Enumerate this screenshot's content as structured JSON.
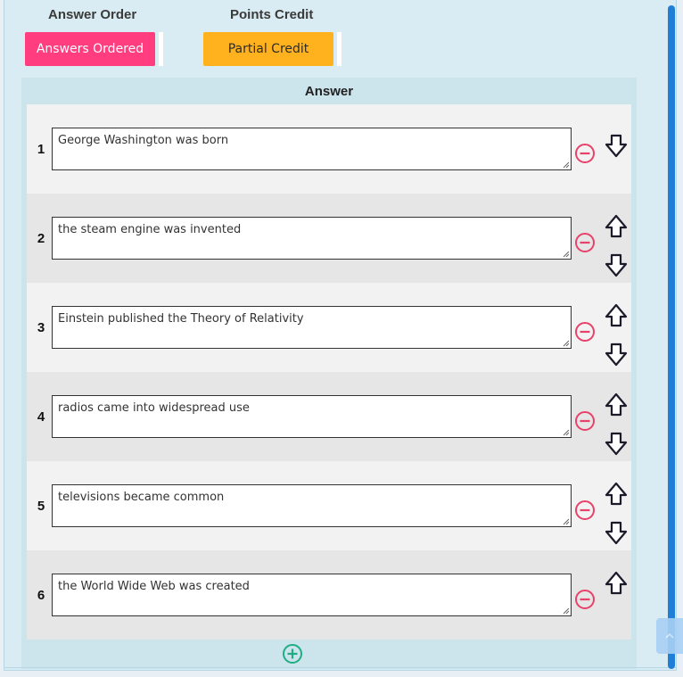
{
  "settings": {
    "answer_order_title": "Answer Order",
    "points_credit_title": "Points Credit",
    "answer_order_button": "Answers Ordered",
    "points_credit_button": "Partial Credit",
    "answer_order_color": "#ff3d7f",
    "points_credit_color": "#ffb21d"
  },
  "answers": {
    "header": "Answer",
    "rows": [
      {
        "number": "1",
        "text": "George Washington was born"
      },
      {
        "number": "2",
        "text": "the steam engine was invented"
      },
      {
        "number": "3",
        "text": "Einstein published the Theory of Relativity"
      },
      {
        "number": "4",
        "text": "radios came into widespread use"
      },
      {
        "number": "5",
        "text": "televisions became common"
      },
      {
        "number": "6",
        "text": "the World Wide Web was created"
      }
    ]
  },
  "icons": {
    "remove": "minus-circle-icon",
    "add": "plus-circle-icon",
    "up": "arrow-up-outline-icon",
    "down": "arrow-down-outline-icon",
    "scroll_top": "chevron-up-icon"
  },
  "colors": {
    "remove_icon": "#e8426a",
    "add_icon": "#1fae84",
    "scrollbar": "#1f7fd6"
  }
}
